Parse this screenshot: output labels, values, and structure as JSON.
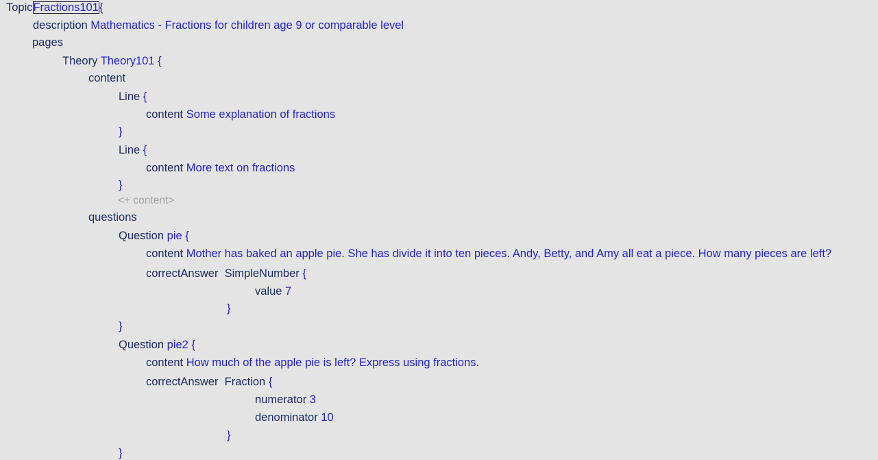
{
  "topic": {
    "keyword": "Topic",
    "name": "Fractions101",
    "open": "{",
    "description_keyword": "description",
    "description": "Mathematics - Fractions for children age 9 or comparable level",
    "pages_keyword": "pages"
  },
  "theory": {
    "keyword": "Theory",
    "name": "Theory101",
    "open": "{",
    "content_keyword": "content",
    "lines": [
      {
        "keyword": "Line",
        "open": "{",
        "content_keyword": "content",
        "content": "Some explanation of fractions",
        "close": "}"
      },
      {
        "keyword": "Line",
        "open": "{",
        "content_keyword": "content",
        "content": "More text on fractions",
        "close": "}"
      }
    ],
    "add_content_placeholder": "<+ content>",
    "questions_keyword": "questions"
  },
  "questions": [
    {
      "keyword": "Question",
      "name": "pie",
      "open": "{",
      "content_keyword": "content",
      "content": "Mother has baked an apple pie. She has divide it into ten pieces. Andy, Betty, and Amy all eat a piece. How many pieces are left?",
      "answer_keyword": "correctAnswer",
      "answer_type": "SimpleNumber",
      "answer_open": "{",
      "fields": [
        {
          "key": "value",
          "val": "7"
        }
      ],
      "answer_close": "}",
      "close": "}"
    },
    {
      "keyword": "Question",
      "name": "pie2",
      "open": "{",
      "content_keyword": "content",
      "content": "How much of the apple pie is left? Express using fractions.",
      "answer_keyword": "correctAnswer",
      "answer_type": "Fraction",
      "answer_open": "{",
      "fields": [
        {
          "key": "numerator",
          "val": "3"
        },
        {
          "key": "denominator",
          "val": "10"
        }
      ],
      "answer_close": "}",
      "close": "}"
    }
  ]
}
